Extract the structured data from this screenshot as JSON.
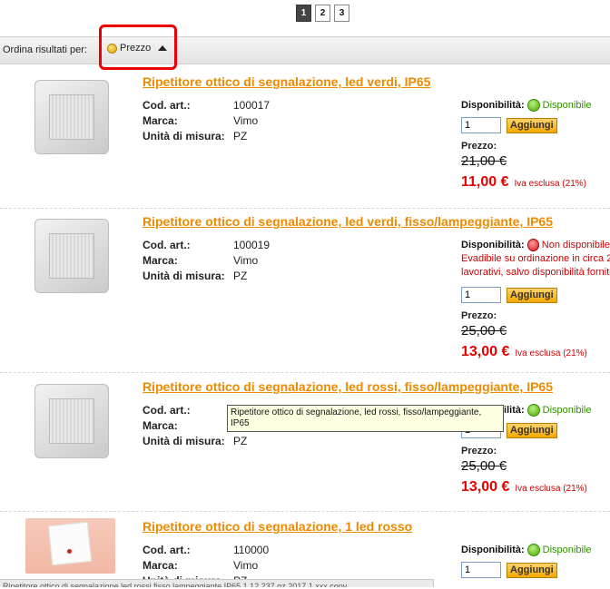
{
  "pagination": {
    "pages": [
      "1",
      "2",
      "3"
    ],
    "active": "1"
  },
  "sort": {
    "label": "Ordina risultati per:",
    "field": "Prezzo"
  },
  "labels": {
    "code": "Cod. art.:",
    "brand": "Marca:",
    "unit": "Unità di misura:",
    "availability": "Disponibilità:",
    "price": "Prezzo:",
    "add": "Aggiungi",
    "vat": "Iva esclusa (21%)"
  },
  "products": [
    {
      "title": "Ripetitore ottico di segnalazione, led verdi, IP65",
      "code": "100017",
      "brand": "Vimo",
      "unit": "PZ",
      "availability": "Disponibile",
      "qty": "1",
      "old_price": "21,00 €",
      "price": "11,00 €"
    },
    {
      "title": "Ripetitore ottico di segnalazione, led verdi, fisso/lampeggiante, IP65",
      "code": "100019",
      "brand": "Vimo",
      "unit": "PZ",
      "availability": "Non disponibile",
      "note1": "Evadibile su ordinazione in circa 2",
      "note2": "lavorativi, salvo disponibilità fornito",
      "qty": "1",
      "old_price": "25,00 €",
      "price": "13,00 €"
    },
    {
      "title": "Ripetitore ottico di segnalazione, led rossi, fisso/lampeggiante, IP65",
      "code": "",
      "brand": "",
      "unit": "PZ",
      "availability": "Disponibile",
      "qty": "1",
      "old_price": "25,00 €",
      "price": "13,00 €"
    },
    {
      "title": "Ripetitore ottico di segnalazione, 1 led rosso",
      "code": "110000",
      "brand": "Vimo",
      "unit": "PZ",
      "availability": "Disponibile",
      "qty": "1"
    }
  ],
  "tooltip": "Ripetitore ottico di segnalazione, led rossi, fisso/lampeggiante, IP65",
  "status_bar": "Ripetitore ottico di segnalazione led rossi fisso lampeggiante IP65 1 12 237 gz 2017 1 xxx copy"
}
